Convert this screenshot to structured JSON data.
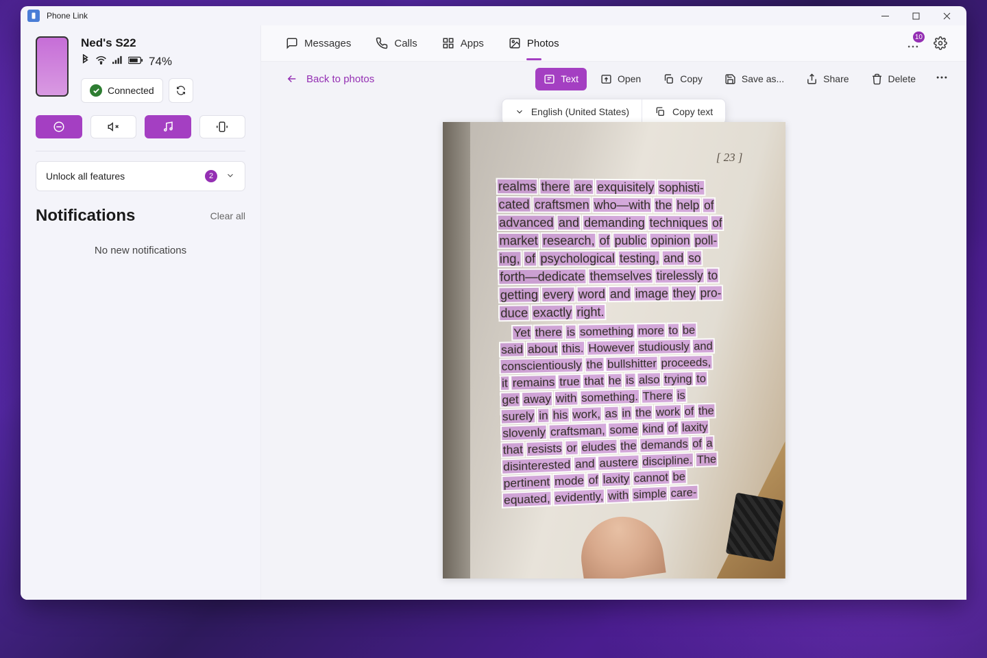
{
  "window": {
    "title": "Phone Link"
  },
  "device": {
    "name": "Ned's S22",
    "battery_pct": "74%",
    "connected_label": "Connected"
  },
  "sidebar": {
    "unlock_label": "Unlock all features",
    "unlock_badge": "2",
    "notifications_title": "Notifications",
    "clear_all": "Clear all",
    "no_notifications": "No new notifications"
  },
  "tabs": {
    "messages": "Messages",
    "calls": "Calls",
    "apps": "Apps",
    "photos": "Photos",
    "badge": "10"
  },
  "toolbar": {
    "back": "Back to photos",
    "text": "Text",
    "open": "Open",
    "copy": "Copy",
    "save_as": "Save as...",
    "share": "Share",
    "delete": "Delete"
  },
  "ocr": {
    "language": "English (United States)",
    "copy_text": "Copy text"
  },
  "photo": {
    "page_number": "[ 23 ]",
    "p1": [
      "realms there are exquisitely sophisti-",
      "cated craftsmen who—with the help of",
      "advanced and demanding techniques of",
      "market research, of public opinion poll-",
      "ing, of psychological testing, and so",
      "forth—dedicate themselves tirelessly to",
      "getting every word and image they pro-",
      "duce exactly right."
    ],
    "p2": [
      "Yet there is something more to be",
      "said about this. However studiously and",
      "conscientiously the bullshitter proceeds,",
      "it remains true that he is also trying to",
      "get away with something. There is",
      "surely in his work, as in the work of the",
      "slovenly craftsman, some kind of laxity",
      "that resists or eludes the demands of a",
      "disinterested and austere discipline. The",
      "pertinent mode of laxity cannot be",
      "equated, evidently, with simple care-"
    ]
  }
}
